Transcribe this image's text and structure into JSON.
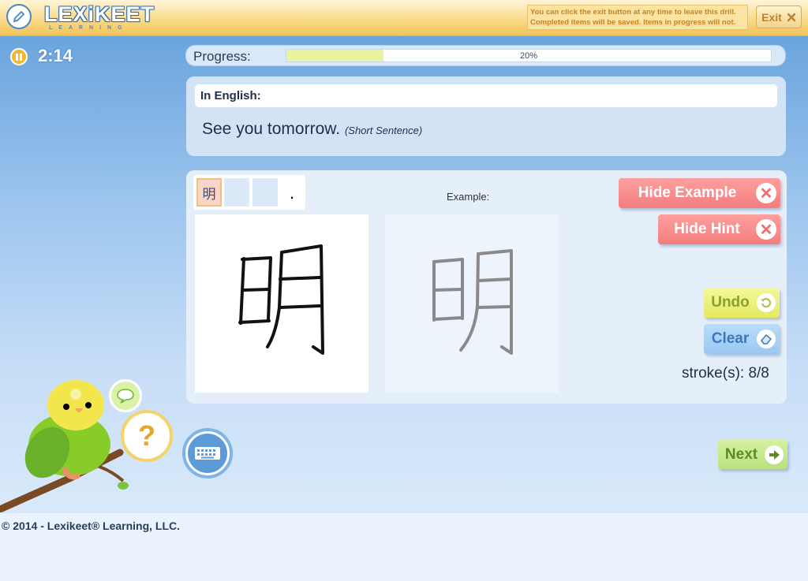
{
  "header": {
    "logo_text": "LEXiKEET",
    "logo_subtext": "LEARNING",
    "exit_note": "You can click the exit button at any time to leave this drill. Completed items will be saved. Items in progress will not.",
    "exit_label": "Exit"
  },
  "timer": {
    "value": "2:14"
  },
  "progress": {
    "label": "Progress:",
    "percent_text": "20%",
    "percent": 20
  },
  "english": {
    "label": "In English:",
    "sentence": "See you tomorrow.",
    "sentence_type": "(Short Sentence)"
  },
  "work": {
    "slots": [
      "明",
      "",
      ""
    ],
    "slot_trailing": ".",
    "example_label": "Example:",
    "drawn_char": "明",
    "example_char": "明",
    "hide_example_label": "Hide Example",
    "hide_hint_label": "Hide Hint",
    "undo_label": "Undo",
    "clear_label": "Clear",
    "strokes_text": "stroke(s): 8/8"
  },
  "helpers": {
    "help_label": "?"
  },
  "next_label": "Next",
  "footer": {
    "copyright": "© 2014 - Lexikeet® Learning, LLC."
  },
  "colors": {
    "header_bg": "#f9d882",
    "accent_blue": "#4a86c8",
    "hide_buttons": "#f47d7d",
    "undo_button": "#e4ea5e",
    "clear_button": "#9ac8f2",
    "next_button": "#b9e27c",
    "progress_fill": "#eaf3a0"
  },
  "icons": [
    "pencil-icon",
    "close-icon",
    "pause-icon",
    "undo-icon",
    "eraser-icon",
    "arrow-right-icon",
    "chat-icon",
    "keyboard-icon",
    "question-icon"
  ]
}
